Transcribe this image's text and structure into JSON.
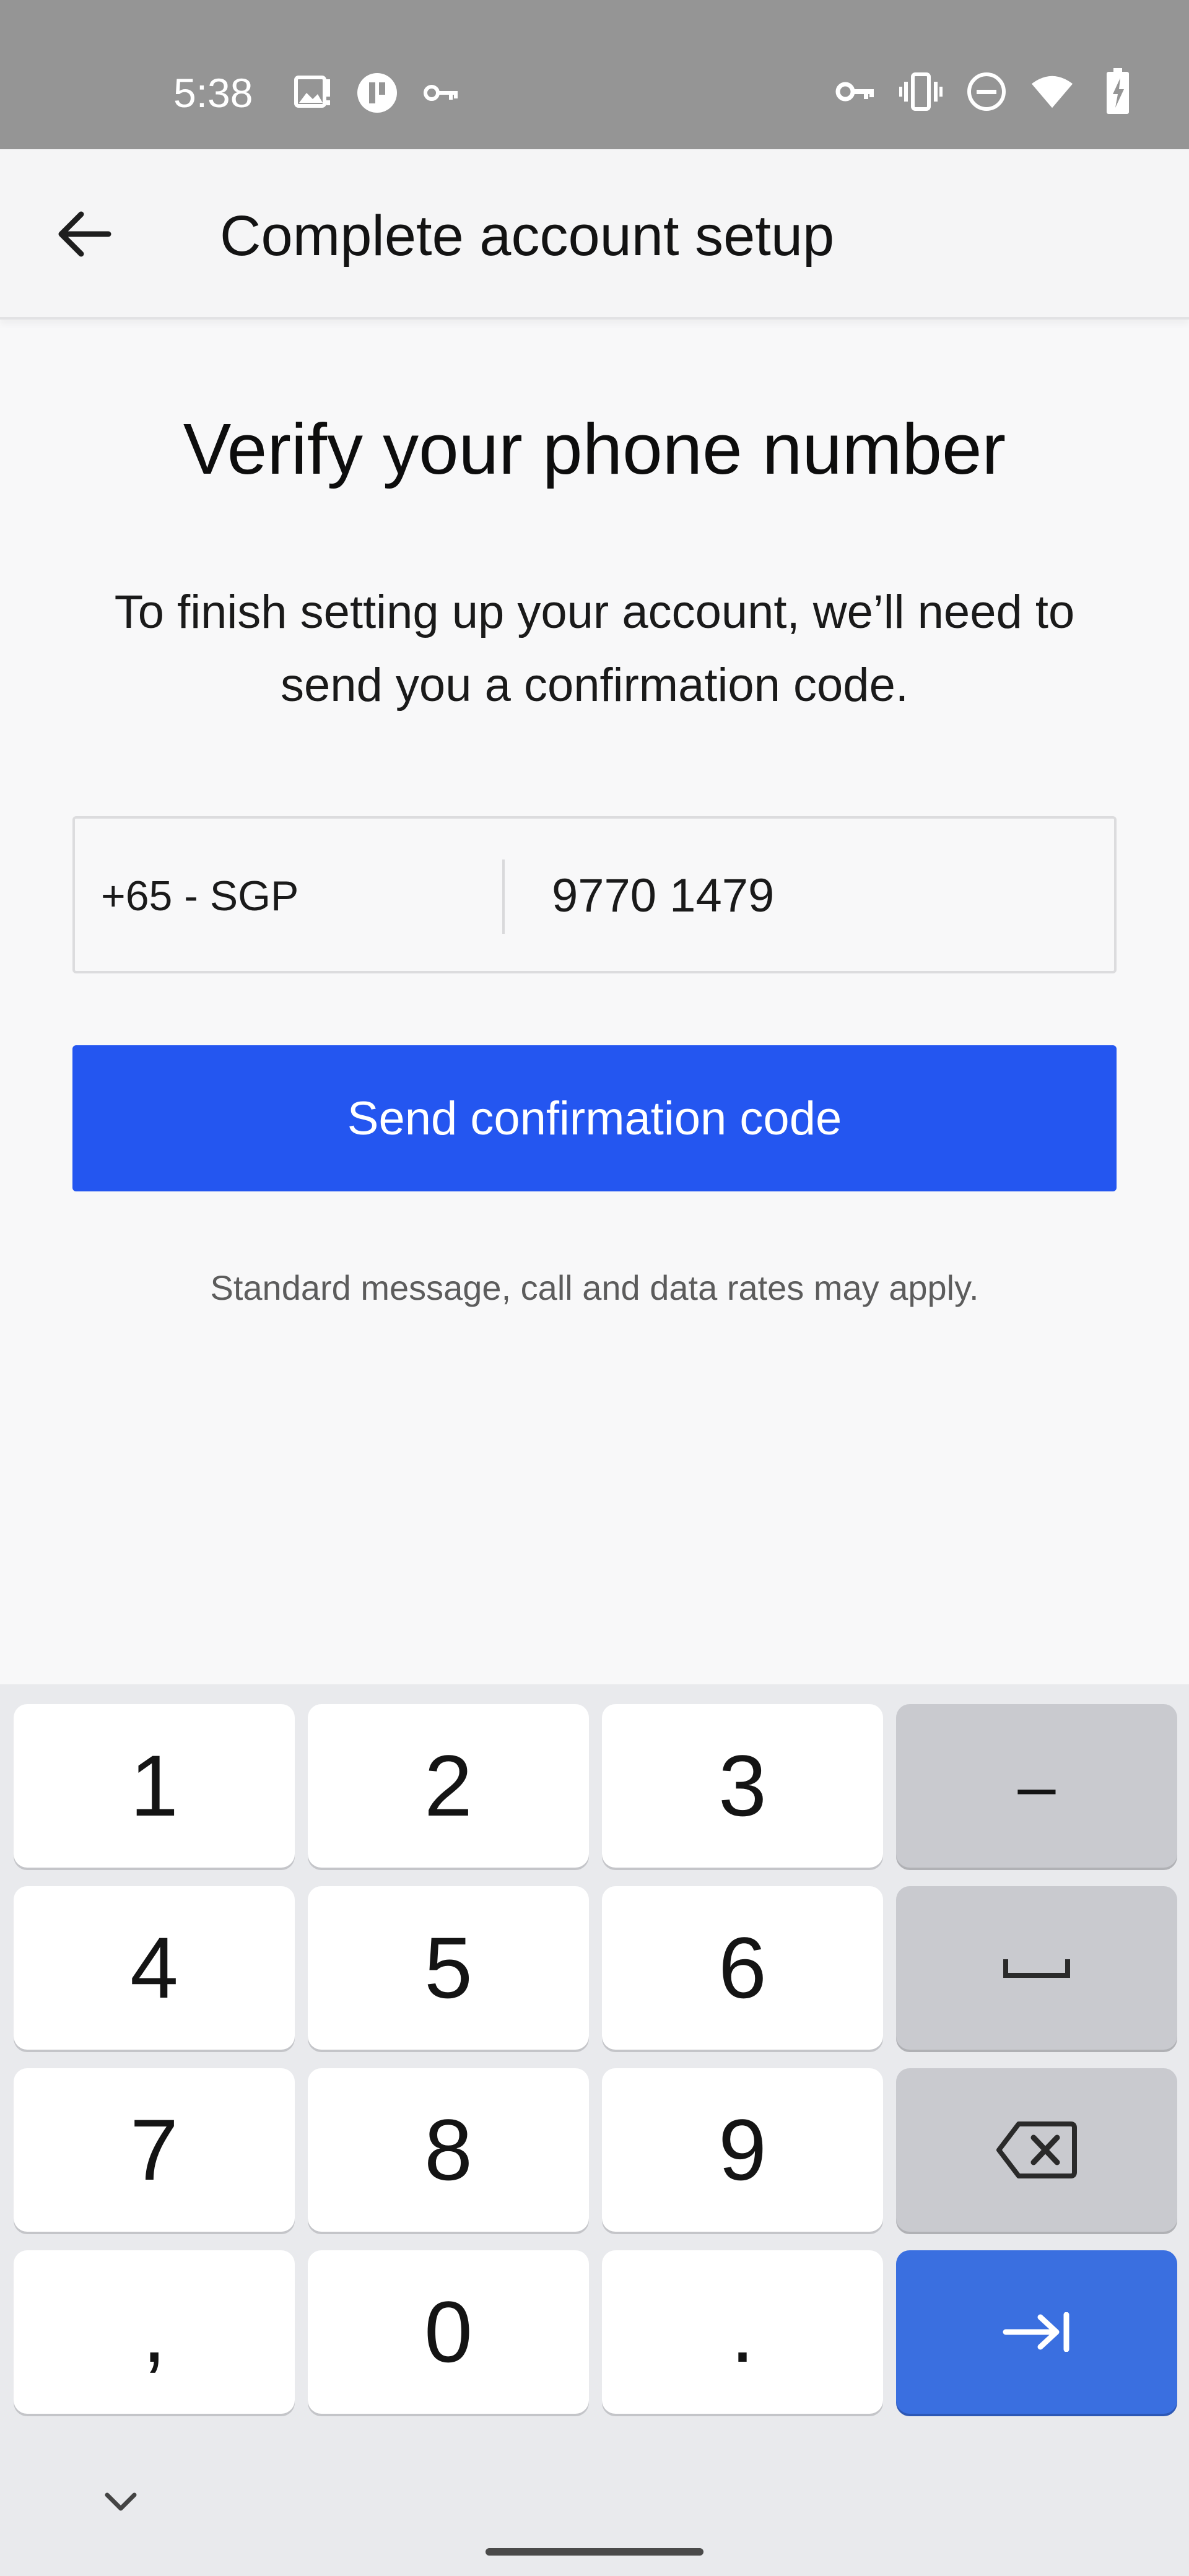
{
  "status_bar": {
    "time": "5:38",
    "left_icons": [
      "image-icon",
      "app-badge-icon",
      "key-icon"
    ],
    "right_icons": [
      "vpn-key-icon",
      "vibrate-icon",
      "do-not-disturb-icon",
      "wifi-icon",
      "battery-charging-icon"
    ]
  },
  "app_bar": {
    "back_icon": "arrow-left-icon",
    "title": "Complete account setup"
  },
  "main": {
    "heading": "Verify your phone number",
    "description": "To finish setting up your account, we’ll need to send you a confirmation code.",
    "phone": {
      "country": "+65 - SGP",
      "number": "9770 1479"
    },
    "send_button": "Send confirmation code",
    "note": "Standard message, call and data rates may apply."
  },
  "keyboard": {
    "rows": [
      [
        "1",
        "2",
        "3",
        "–"
      ],
      [
        "4",
        "5",
        "6",
        "space"
      ],
      [
        "7",
        "8",
        "9",
        "backspace"
      ],
      [
        ",",
        "0",
        ".",
        "next"
      ]
    ],
    "keys": {
      "k1": "1",
      "k2": "2",
      "k3": "3",
      "dash": "–",
      "k4": "4",
      "k5": "5",
      "k6": "6",
      "k7": "7",
      "k8": "8",
      "k9": "9",
      "comma": ",",
      "k0": "0",
      "period": "."
    },
    "colors": {
      "accent": "#2456f0",
      "enter": "#3a6fe0"
    }
  }
}
